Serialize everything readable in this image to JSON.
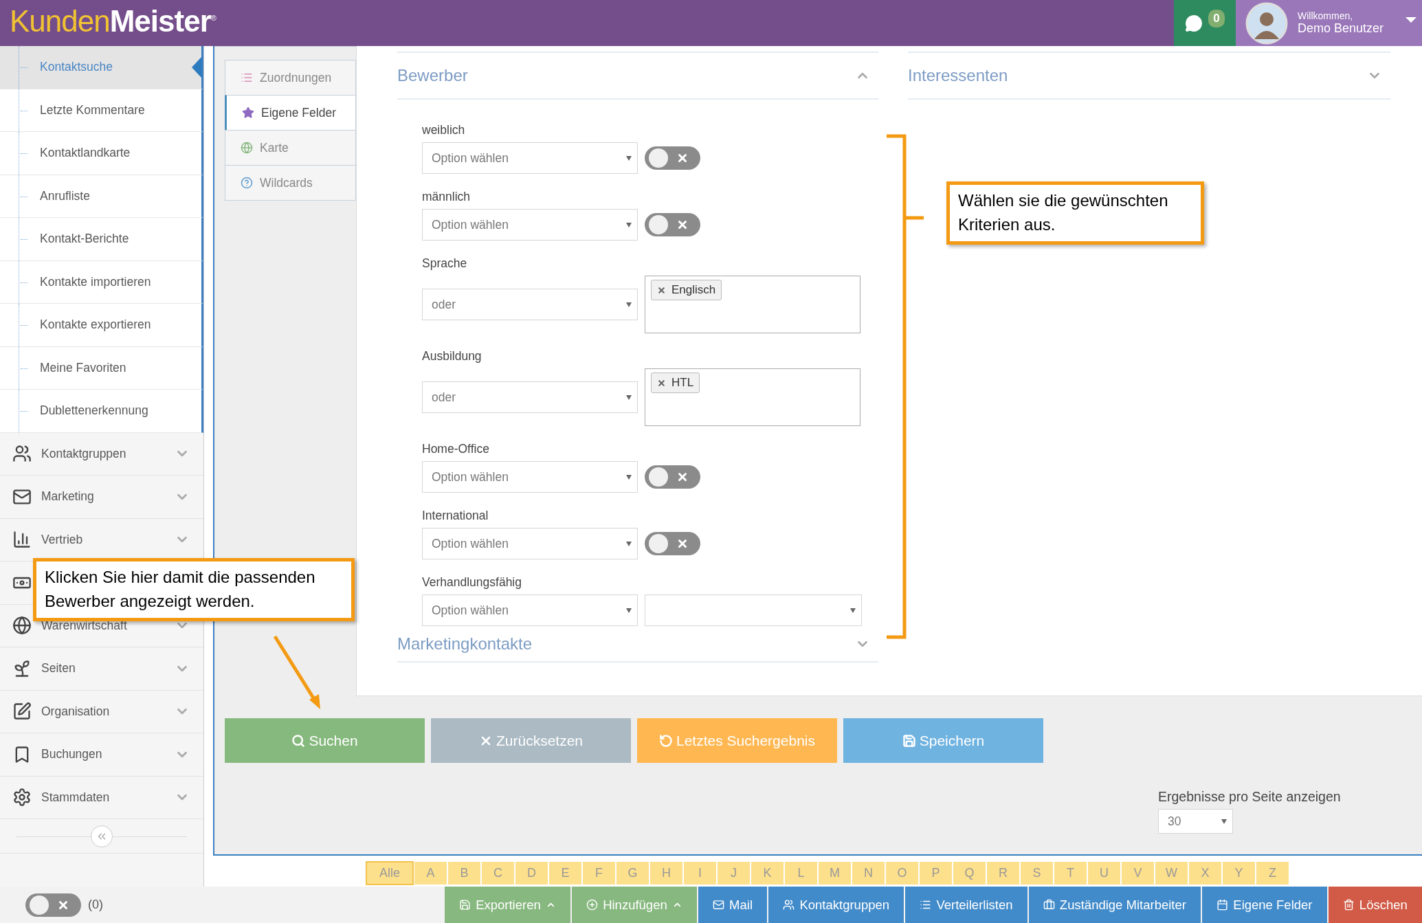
{
  "header": {
    "logo_first": "Kunden",
    "logo_second": "Meister",
    "logo_mark": "®",
    "message_count": "0",
    "greeting": "Willkommen,",
    "user_name": "Demo Benutzer"
  },
  "sidebar": {
    "subitems": [
      {
        "label": "Kontaktsuche",
        "selected": true
      },
      {
        "label": "Letzte Kommentare",
        "selected": false
      },
      {
        "label": "Kontaktlandkarte",
        "selected": false
      },
      {
        "label": "Anrufliste",
        "selected": false
      },
      {
        "label": "Kontakt-Berichte",
        "selected": false
      },
      {
        "label": "Kontakte importieren",
        "selected": false
      },
      {
        "label": "Kontakte exportieren",
        "selected": false
      },
      {
        "label": "Meine Favoriten",
        "selected": false
      },
      {
        "label": "Dublettenerkennung",
        "selected": false
      }
    ],
    "groups": [
      {
        "kind": "item",
        "label": "Kontaktgruppen",
        "expanded": false
      },
      {
        "kind": "item",
        "label": "Marketing",
        "expanded": false
      },
      {
        "kind": "item",
        "label": "Vertrieb",
        "expanded": false
      },
      {
        "kind": "icon"
      },
      {
        "kind": "item",
        "label": "Warenwirtschaft",
        "expanded": false
      },
      {
        "kind": "item",
        "label": "Seiten",
        "expanded": false
      },
      {
        "kind": "item",
        "label": "Organisation",
        "expanded": false
      },
      {
        "kind": "item",
        "label": "Buchungen",
        "expanded": false
      },
      {
        "kind": "item",
        "label": "Stammdaten",
        "expanded": false
      }
    ]
  },
  "tabs": [
    {
      "label": "Zuordnungen",
      "selected": false
    },
    {
      "label": "Eigene Felder",
      "selected": true
    },
    {
      "label": "Karte",
      "selected": false
    },
    {
      "label": "Wildcards",
      "selected": false
    }
  ],
  "panels": [
    {
      "title": "Bewerber",
      "expanded": true
    },
    {
      "title": "Interessenten",
      "expanded": false
    }
  ],
  "fields": [
    {
      "label": "weiblich",
      "kind": "toggle",
      "value": "Option wählen",
      "on": false
    },
    {
      "label": "männlich",
      "kind": "toggle",
      "value": "Option wählen",
      "on": false
    },
    {
      "label": "Sprache",
      "kind": "tags",
      "value": "oder",
      "tags": [
        "Englisch"
      ]
    },
    {
      "label": "Ausbildung",
      "kind": "tags",
      "value": "oder",
      "tags": [
        "HTL"
      ]
    },
    {
      "label": "Home-Office",
      "kind": "toggle",
      "value": "Option wählen",
      "on": false
    },
    {
      "label": "International",
      "kind": "toggle",
      "value": "Option wählen",
      "on": false
    },
    {
      "label": "Verhandlungsfähig",
      "kind": "dual",
      "value": "Option wählen"
    }
  ],
  "lower_panel": {
    "title": "Marketingkontakte",
    "expanded": false
  },
  "actions": [
    {
      "label": "Suchen",
      "color": "#86b97d"
    },
    {
      "label": "Zurücksetzen",
      "color": "#abbac3"
    },
    {
      "label": "Letztes Suchergebnis",
      "color": "#ffb752"
    },
    {
      "label": "Speichern",
      "color": "#6fb3e0"
    }
  ],
  "results_per_page": {
    "label": "Ergebnisse pro Seite anzeigen",
    "value": "30"
  },
  "alphabet": [
    {
      "label": "Alle",
      "selected": true
    },
    {
      "label": "A",
      "selected": false
    },
    {
      "label": "B",
      "selected": false
    },
    {
      "label": "C",
      "selected": false
    },
    {
      "label": "D",
      "selected": false
    },
    {
      "label": "E",
      "selected": false
    },
    {
      "label": "F",
      "selected": false
    },
    {
      "label": "G",
      "selected": false
    },
    {
      "label": "H",
      "selected": false
    },
    {
      "label": "I",
      "selected": false
    },
    {
      "label": "J",
      "selected": false
    },
    {
      "label": "K",
      "selected": false
    },
    {
      "label": "L",
      "selected": false
    },
    {
      "label": "M",
      "selected": false
    },
    {
      "label": "N",
      "selected": false
    },
    {
      "label": "O",
      "selected": false
    },
    {
      "label": "P",
      "selected": false
    },
    {
      "label": "Q",
      "selected": false
    },
    {
      "label": "R",
      "selected": false
    },
    {
      "label": "S",
      "selected": false
    },
    {
      "label": "T",
      "selected": false
    },
    {
      "label": "U",
      "selected": false
    },
    {
      "label": "V",
      "selected": false
    },
    {
      "label": "W",
      "selected": false
    },
    {
      "label": "X",
      "selected": false
    },
    {
      "label": "Y",
      "selected": false
    },
    {
      "label": "Z",
      "selected": false
    }
  ],
  "footer": {
    "toggle_on": false,
    "count": "(0)",
    "buttons": [
      {
        "label": "Exportieren",
        "color": "#87b87f",
        "dropdown": true
      },
      {
        "label": "Hinzufügen",
        "color": "#87b87f",
        "dropdown": true
      },
      {
        "label": "Mail",
        "color": "#428bca",
        "dropdown": false
      },
      {
        "label": "Kontaktgruppen",
        "color": "#428bca",
        "dropdown": false
      },
      {
        "label": "Verteilerlisten",
        "color": "#428bca",
        "dropdown": false
      },
      {
        "label": "Zuständige Mitarbeiter",
        "color": "#428bca",
        "dropdown": false
      },
      {
        "label": "Eigene Felder",
        "color": "#428bca",
        "dropdown": false
      },
      {
        "label": "Löschen",
        "color": "#d15b47",
        "dropdown": false
      }
    ]
  },
  "callouts": [
    {
      "text": "Wählen sie die gewünschten Kriterien aus."
    },
    {
      "text": "Klicken Sie hier damit die passenden Bewerber angezeigt werden."
    }
  ]
}
